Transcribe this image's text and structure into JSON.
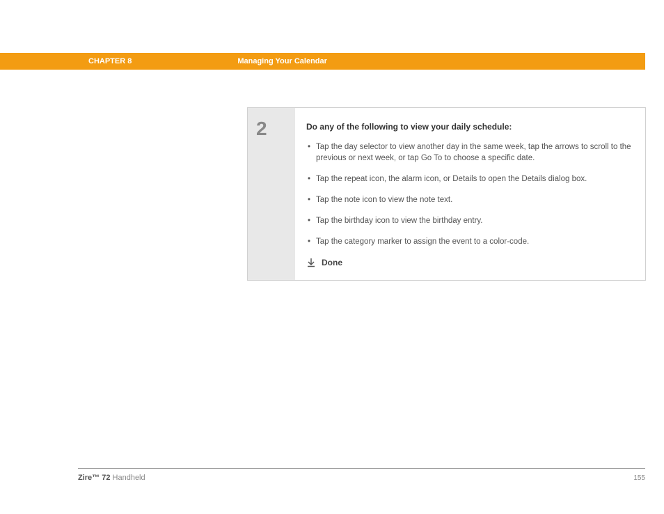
{
  "header": {
    "chapter_label": "CHAPTER 8",
    "chapter_title": "Managing Your Calendar"
  },
  "step": {
    "number": "2",
    "heading": "Do any of the following to view your daily schedule:",
    "bullets": [
      "Tap the day selector to view another day in the same week, tap the arrows to scroll to the previous or next week, or tap Go To to choose a specific date.",
      "Tap the repeat icon, the alarm icon, or Details to open the Details dialog box.",
      "Tap the note icon to view the note text.",
      "Tap the birthday icon to view the birthday entry.",
      "Tap the category marker to assign the event to a color-code."
    ],
    "done_label": "Done"
  },
  "footer": {
    "product_bold": "Zire™ 72",
    "product_suffix": " Handheld",
    "page_number": "155"
  }
}
